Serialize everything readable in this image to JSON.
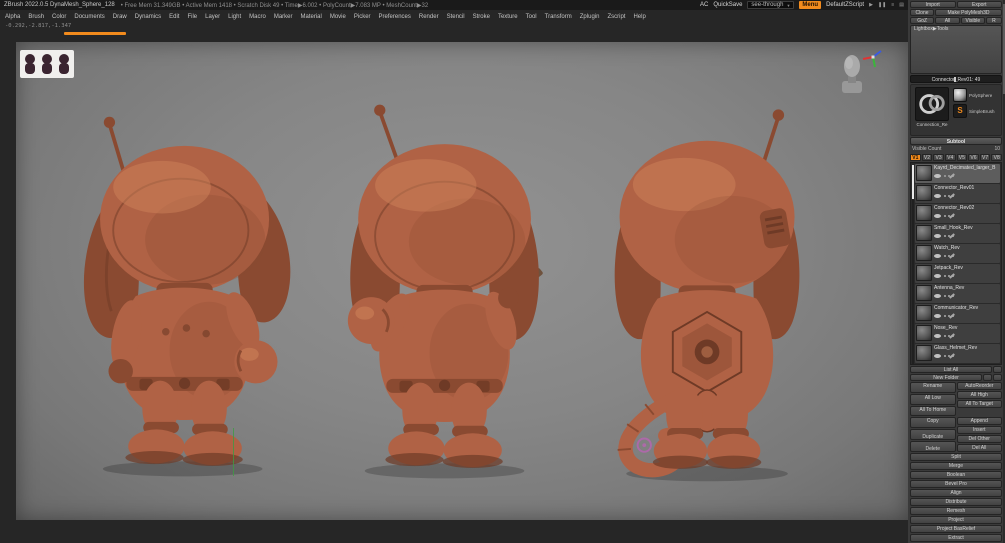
{
  "colors": {
    "accent": "#f28b1d",
    "clay": "#b06245",
    "clay-dark": "#8a4a31",
    "clay-deep": "#6e3a26",
    "clay-light": "#cd8159"
  },
  "title_bar": {
    "app_title": "ZBrush 2022.0.5 DynaMesh_Sphere_128",
    "stats": "• Free Mem 31.349GB • Active Mem 1418 • Scratch Disk 49 • Time▶6.002 • PolyCount▶7.083 MP • MeshCount▶32",
    "ac_label": "AC",
    "quicksave_label": "QuickSave",
    "see_through_label": "see-through",
    "menu_label": "Menu",
    "zscript_label": "DefaultZScript"
  },
  "icons": {
    "dropdown_arrow": "▼",
    "play": "▶",
    "pause": "❚❚",
    "list": "≡",
    "grid": "▤",
    "simple_brush_glyph": "S"
  },
  "menu_bar": {
    "items": [
      "Alpha",
      "Brush",
      "Color",
      "Documents",
      "Draw",
      "Dynamics",
      "Edit",
      "File",
      "Layer",
      "Light",
      "Macro",
      "Marker",
      "Material",
      "Movie",
      "Picker",
      "Preferences",
      "Render",
      "Stencil",
      "Stroke",
      "Texture",
      "Tool",
      "Transform",
      "Zplugin",
      "Zscript",
      "Help"
    ]
  },
  "status": {
    "coordinates": "-0.292,-2.817,-1.347"
  },
  "tool_panel": {
    "import_label": "Import",
    "export_label": "Export",
    "clone_label": "Clone",
    "make_polymesh_label": "Make PolyMesh3D",
    "goz_label": "GoZ",
    "all_label": "All",
    "visible_label": "Visible",
    "r_label": "R",
    "lightbox_label": "Lightbox▶Tools",
    "slider_label": "Connector_Rev01:",
    "slider_value": "49",
    "current_tool_caption": "Connection_Re",
    "recent_tools": [
      "PolySphere",
      "SimpleBrush"
    ],
    "subtool": {
      "header": "Subtool",
      "visible_count_label": "Visible Count",
      "visible_count": "10",
      "tabs": [
        {
          "label": "V1",
          "active": true
        },
        {
          "label": "V2"
        },
        {
          "label": "V3"
        },
        {
          "label": "V4"
        },
        {
          "label": "V5"
        },
        {
          "label": "V6"
        },
        {
          "label": "V7"
        },
        {
          "label": "V8"
        }
      ],
      "items": [
        {
          "name": "Kayrd_Decimated_larger_B",
          "selected": true
        },
        {
          "name": "Connector_Rev01"
        },
        {
          "name": "Connector_Rev02"
        },
        {
          "name": "Small_Hook_Rev"
        },
        {
          "name": "Watch_Rev"
        },
        {
          "name": "Jetpack_Rev"
        },
        {
          "name": "Antenna_Rev"
        },
        {
          "name": "Communicator_Rev"
        },
        {
          "name": "Nose_Rev"
        },
        {
          "name": "Glass_Helmet_Rev"
        }
      ],
      "list_all_label": "List All",
      "new_folder_label": "New Folder"
    },
    "actions": {
      "rename": "Rename",
      "auto_reorder": "AutoReorder",
      "all_low": "All Low",
      "all_high": "All High",
      "all_to_home": "All To Home",
      "all_to_target": "All To Target",
      "copy": "Copy",
      "duplicate": "Duplicate",
      "append": "Append",
      "insert": "Insert",
      "delete": "Delete",
      "del_other": "Del Other",
      "del_all": "Del All"
    },
    "sections": [
      "Split",
      "Merge",
      "Boolean",
      "Bevel Pro",
      "Align",
      "Distribute",
      "Remesh",
      "Project",
      "Project BasRelief",
      "Extract"
    ]
  }
}
